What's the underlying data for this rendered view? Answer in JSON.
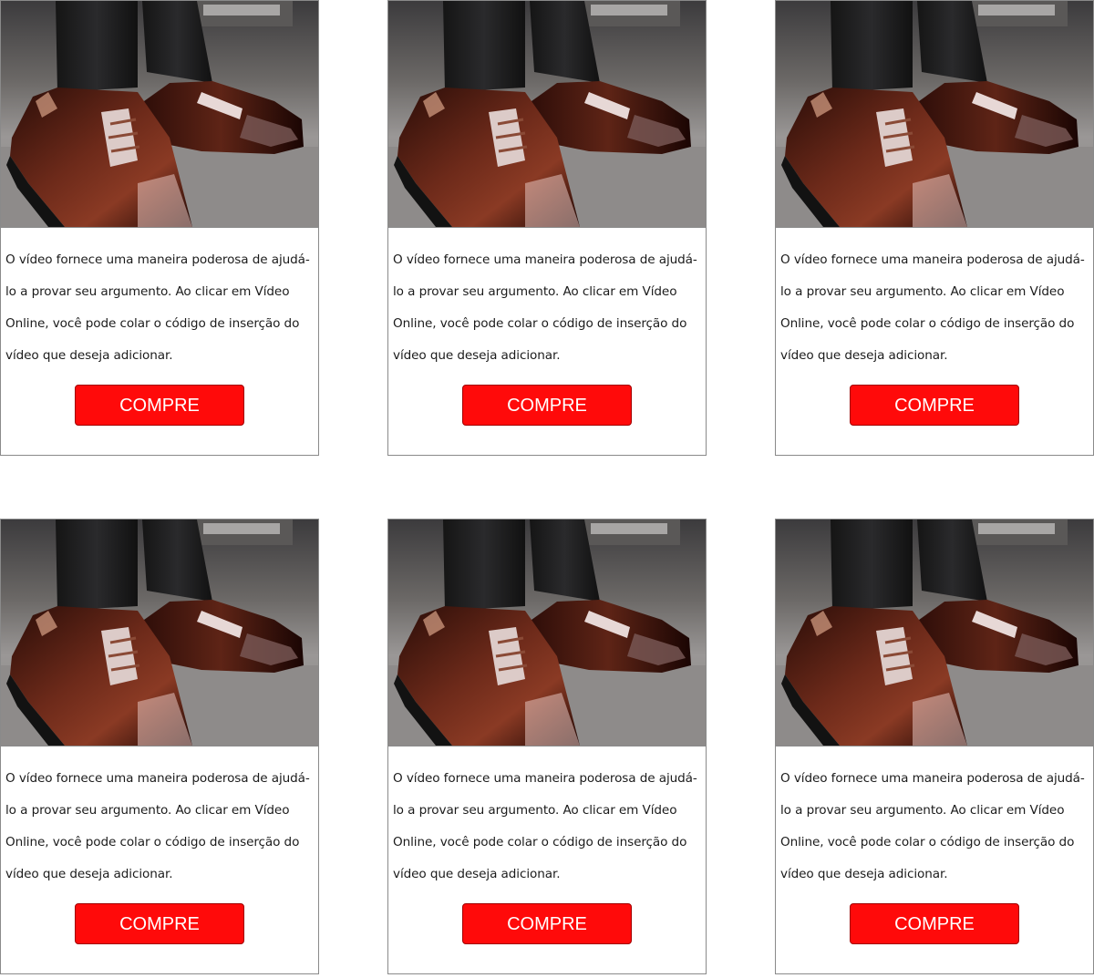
{
  "product_cards": [
    {
      "image": "men-brown-leather-dress-shoes-photo",
      "description": "O vídeo fornece uma maneira poderosa de ajudá-lo a provar seu argumento. Ao clicar em Vídeo Online, você pode colar o código de inserção do vídeo que deseja adicionar.",
      "button_label": "COMPRE"
    },
    {
      "image": "men-brown-leather-dress-shoes-photo",
      "description": "O vídeo fornece uma maneira poderosa de ajudá-lo a provar seu argumento. Ao clicar em Vídeo Online, você pode colar o código de inserção do vídeo que deseja adicionar.",
      "button_label": "COMPRE"
    },
    {
      "image": "men-brown-leather-dress-shoes-photo",
      "description": "O vídeo fornece uma maneira poderosa de ajudá-lo a provar seu argumento. Ao clicar em Vídeo Online, você pode colar o código de inserção do vídeo que deseja adicionar.",
      "button_label": "COMPRE"
    },
    {
      "image": "men-brown-leather-dress-shoes-photo",
      "description": "O vídeo fornece uma maneira poderosa de ajudá-lo a provar seu argumento. Ao clicar em Vídeo Online, você pode colar o código de inserção do vídeo que deseja adicionar.",
      "button_label": "COMPRE"
    },
    {
      "image": "men-brown-leather-dress-shoes-photo",
      "description": "O vídeo fornece uma maneira poderosa de ajudá-lo a provar seu argumento. Ao clicar em Vídeo Online, você pode colar o código de inserção do vídeo que deseja adicionar.",
      "button_label": "COMPRE"
    },
    {
      "image": "men-brown-leather-dress-shoes-photo",
      "description": "O vídeo fornece uma maneira poderosa de ajudá-lo a provar seu argumento. Ao clicar em Vídeo Online, você pode colar o código de inserção do vídeo que deseja adicionar.",
      "button_label": "COMPRE"
    }
  ],
  "colors": {
    "button_background": "#ff0a0a",
    "button_text": "#ffffff",
    "card_border": "#8a8a8a",
    "text": "#1b1b1b"
  }
}
